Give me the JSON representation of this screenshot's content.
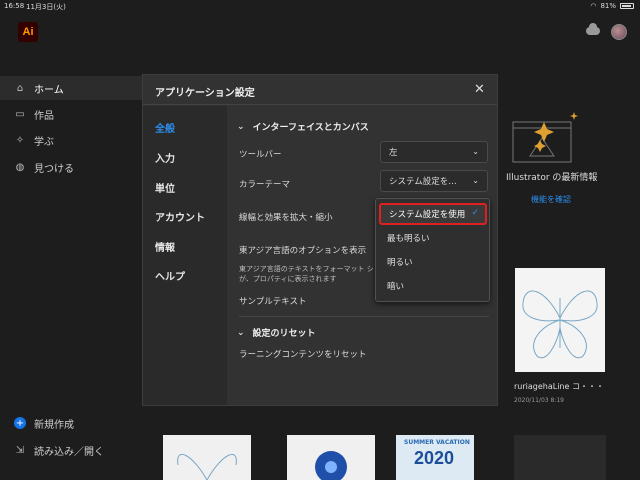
{
  "status": {
    "time": "16:58",
    "date": "11月3日(火)",
    "battery": "81%"
  },
  "app": {
    "logo": "Ai"
  },
  "sidebar": {
    "items": [
      {
        "label": "ホーム",
        "icon": "home-icon"
      },
      {
        "label": "作品",
        "icon": "folder-icon"
      },
      {
        "label": "学ぶ",
        "icon": "bulb-icon"
      },
      {
        "label": "見つける",
        "icon": "globe-icon"
      }
    ],
    "new_label": "新規作成",
    "import_label": "読み込み／開く"
  },
  "background": {
    "whatsnew_title": "Illustrator の最新情報",
    "whatsnew_link": "機能を確認",
    "card_name": "ruriagehaLine コ・・・",
    "card_date": "2020/11/03 8:19",
    "summer_text": "SUMMER VACATION",
    "year_text": "2020"
  },
  "modal": {
    "title": "アプリケーション設定",
    "nav": [
      "全般",
      "入力",
      "単位",
      "アカウント",
      "情報",
      "ヘルプ"
    ],
    "section1": "インターフェイスとカンバス",
    "toolbar_label": "ツールバー",
    "toolbar_value": "左",
    "theme_label": "カラーテーマ",
    "theme_value": "システム設定を…",
    "scale_label": "線幅と効果を拡大・縮小",
    "eastasia_label": "東アジア言語のオプションを表示",
    "eastasia_desc": "東アジア言語のテキストをフォーマット ションが、プロパティに表示されます",
    "sample_label": "サンプルテキスト",
    "section2": "設定のリセット",
    "reset_label": "ラーニングコンテンツをリセット"
  },
  "dropdown": {
    "options": [
      "システム設定を使用",
      "最も明るい",
      "明るい",
      "暗い"
    ],
    "selected_index": 0
  },
  "colors": {
    "accent": "#2d8ceb",
    "highlight": "#e02020"
  }
}
